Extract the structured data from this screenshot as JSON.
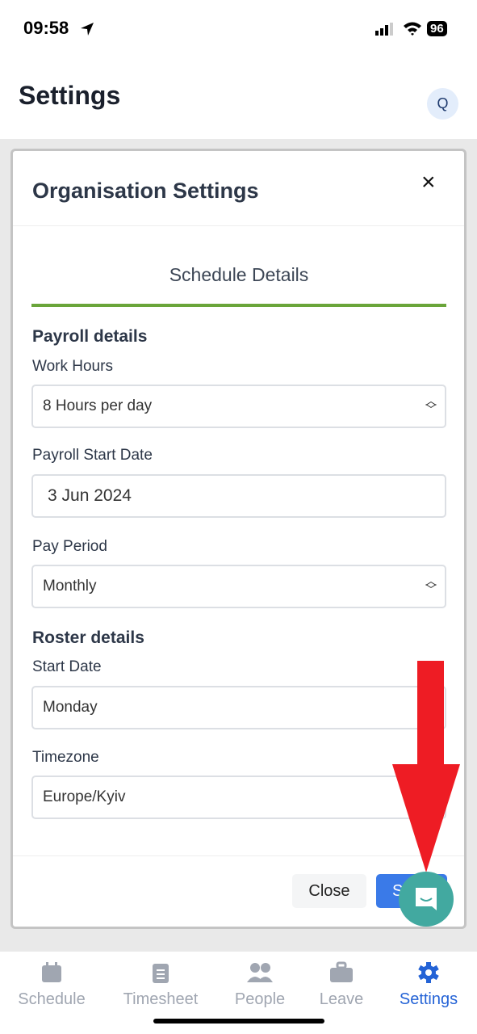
{
  "status_bar": {
    "time": "09:58",
    "battery": "96"
  },
  "header": {
    "title": "Settings",
    "avatar": "Q"
  },
  "modal": {
    "title": "Organisation Settings",
    "close_icon": "×",
    "tab": "Schedule Details",
    "payroll": {
      "heading": "Payroll details",
      "work_hours": {
        "label": "Work Hours",
        "value": "8 Hours per day"
      },
      "start_date": {
        "label": "Payroll Start Date",
        "value": "3 Jun 2024"
      },
      "pay_period": {
        "label": "Pay Period",
        "value": "Monthly"
      }
    },
    "roster": {
      "heading": "Roster details",
      "start_date": {
        "label": "Start Date",
        "value": "Monday"
      },
      "timezone": {
        "label": "Timezone",
        "value": "Europe/Kyiv"
      }
    },
    "buttons": {
      "close": "Close",
      "save": "Save"
    }
  },
  "nav": [
    {
      "label": "Schedule",
      "icon": "calendar-icon"
    },
    {
      "label": "Timesheet",
      "icon": "clipboard-icon"
    },
    {
      "label": "People",
      "icon": "people-icon"
    },
    {
      "label": "Leave",
      "icon": "briefcase-icon"
    },
    {
      "label": "Settings",
      "icon": "gear-icon",
      "active": true
    }
  ],
  "colors": {
    "accent": "#2463d6",
    "tab_underline": "#6aa53a",
    "chat": "#42a9a0",
    "annotation_arrow": "#ee1c24"
  }
}
